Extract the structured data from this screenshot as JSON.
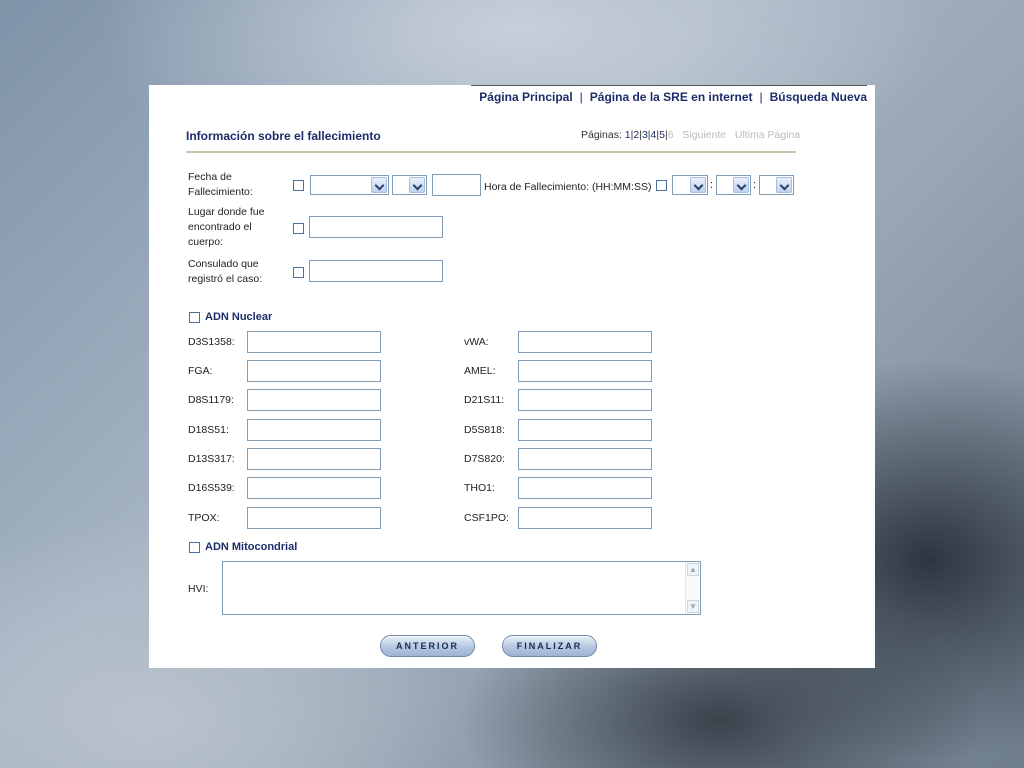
{
  "nav": {
    "home": "Página Principal",
    "sre": "Página de la SRE en internet",
    "new_search": "Búsqueda Nueva",
    "separator": "|"
  },
  "section": {
    "title": "Información sobre el fallecimiento"
  },
  "pagination": {
    "label": "Páginas:",
    "pages": [
      "1",
      "2",
      "3",
      "4",
      "5",
      "6"
    ],
    "separator": "|",
    "next": "Siguiente",
    "last": "Ultima Página"
  },
  "death": {
    "date_label_1": "Fecha de",
    "date_label_2": "Fallecimiento:",
    "time_label": "Hora de Fallecimiento: (HH:MM:SS)",
    "time_sep": ":",
    "place_label_1": "Lugar donde fue",
    "place_label_2": "encontrado el",
    "place_label_3": "cuerpo:",
    "consulate_label_1": "Consulado que",
    "consulate_label_2": "registró el caso:"
  },
  "dna_nuclear": {
    "title": "ADN Nuclear",
    "left": [
      "D3S1358:",
      "FGA:",
      "D8S1179:",
      "D18S51:",
      "D13S317:",
      "D16S539:",
      "TPOX:"
    ],
    "right": [
      "vWA:",
      "AMEL:",
      "D21S11:",
      "D5S818:",
      "D7S820:",
      "THO1:",
      "CSF1PO:"
    ]
  },
  "dna_mito": {
    "title": "ADN Mitocondrial",
    "hvi_label": "HVI:"
  },
  "buttons": {
    "previous": "ANTERIOR",
    "finish": "FINALIZAR"
  }
}
